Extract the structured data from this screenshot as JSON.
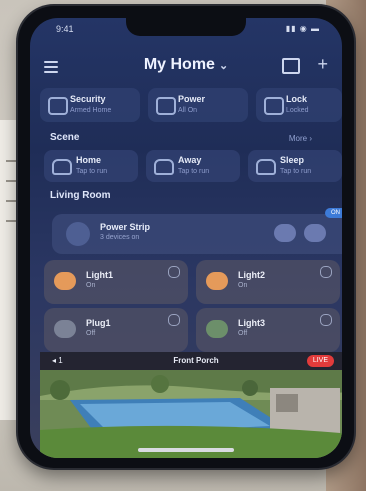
{
  "status_bar": {
    "time": "9:41",
    "system": "▮▮ ◉ ▬"
  },
  "header": {
    "title": "My Home",
    "chevron": "⌄",
    "add_icon": "+"
  },
  "quick_access": [
    {
      "label": "Security",
      "sub": "Armed Home",
      "icon": "shield-icon"
    },
    {
      "label": "Power",
      "sub": "All On",
      "icon": "power-icon"
    },
    {
      "label": "Lock",
      "sub": "Locked",
      "icon": "lock-icon"
    }
  ],
  "scenes": {
    "title": "Scene",
    "more": "More ›",
    "items": [
      {
        "label": "Home",
        "sub": "Tap to run"
      },
      {
        "label": "Away",
        "sub": "Tap to run"
      },
      {
        "label": "Sleep",
        "sub": "Tap to run"
      }
    ]
  },
  "living_room": {
    "title": "Living Room",
    "power_strip": {
      "label": "Power Strip",
      "sub": "3 devices on",
      "badge": "ON"
    },
    "devices": [
      {
        "label": "Light1",
        "sub": "On",
        "color": "#e59a5a"
      },
      {
        "label": "Light2",
        "sub": "On",
        "color": "#e59a5a"
      },
      {
        "label": "Plug1",
        "sub": "Off",
        "color": "#7b8296"
      },
      {
        "label": "Light3",
        "sub": "Off",
        "color": "#6c8f6a"
      }
    ]
  },
  "camera": {
    "left": "◂ 1",
    "title": "Front Porch",
    "live": "LIVE"
  }
}
